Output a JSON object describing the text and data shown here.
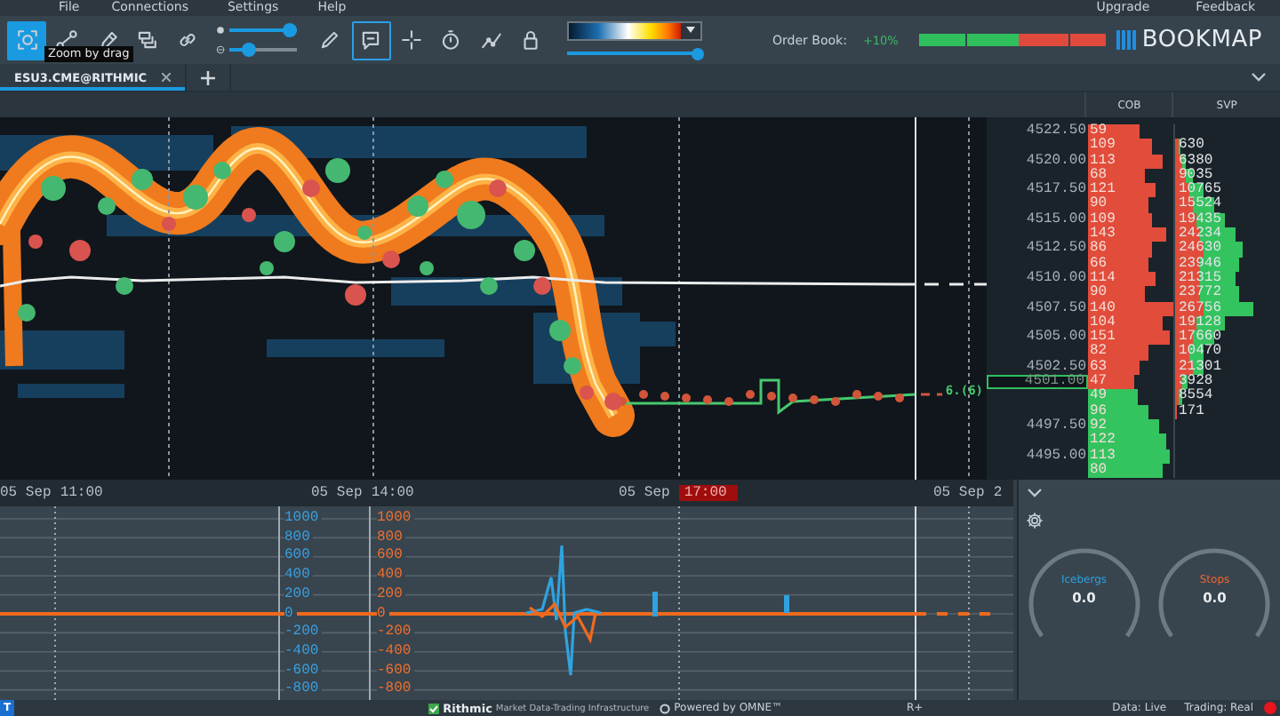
{
  "menu": {
    "left": [
      "File",
      "Connections",
      "Settings",
      "Help"
    ],
    "right": [
      "Upgrade",
      "Feedback"
    ]
  },
  "toolbar": {
    "tools_left": [
      {
        "selected": true,
        "highlighted": false
      },
      {
        "selected": false,
        "highlighted": false
      },
      {
        "selected": false,
        "highlighted": false
      },
      {
        "selected": false,
        "highlighted": false
      },
      {
        "selected": false,
        "highlighted": false
      }
    ],
    "tooltip": "Zoom by drag",
    "sliders": [
      {
        "level": 0.9
      },
      {
        "level": 0.3
      }
    ],
    "tools_right": [
      {
        "selected": false,
        "highlighted": false
      },
      {
        "selected": false,
        "highlighted": true
      },
      {
        "selected": false,
        "highlighted": false
      },
      {
        "selected": false,
        "highlighted": false
      },
      {
        "selected": false,
        "highlighted": false
      },
      {
        "selected": false,
        "highlighted": false
      }
    ],
    "color_scale": {
      "level": 0.98
    },
    "order_book": {
      "label": "Order Book:",
      "change": "+10%",
      "level": 0.53
    },
    "logo": "BOOKMAP"
  },
  "tabs": [
    {
      "label": "ESU3.CME@RITHMIC",
      "selected": true
    }
  ],
  "columns": [
    "COB",
    "SVP"
  ],
  "price_ladder": [
    {
      "price": "4522.50",
      "cob": "59",
      "kind": "ask",
      "current": false
    },
    {
      "cob": "109",
      "kind": "ask",
      "svp": "630",
      "current": false
    },
    {
      "price": "4520.00",
      "cob": "113",
      "kind": "ask",
      "svp": "6380",
      "current": false
    },
    {
      "cob": "68",
      "kind": "ask",
      "svp": "9035",
      "current": false
    },
    {
      "price": "4517.50",
      "cob": "121",
      "kind": "ask",
      "svp": "10765",
      "current": false
    },
    {
      "cob": "90",
      "kind": "ask",
      "svp": "15524",
      "current": false
    },
    {
      "price": "4515.00",
      "cob": "109",
      "kind": "ask",
      "svp": "19435",
      "current": false
    },
    {
      "cob": "143",
      "kind": "ask",
      "svp": "24234",
      "current": false
    },
    {
      "price": "4512.50",
      "cob": "86",
      "kind": "ask",
      "svp": "24630",
      "current": false
    },
    {
      "cob": "66",
      "kind": "ask",
      "svp": "23946",
      "current": false
    },
    {
      "price": "4510.00",
      "cob": "114",
      "kind": "ask",
      "svp": "21315",
      "current": false
    },
    {
      "cob": "90",
      "kind": "ask",
      "svp": "23772",
      "current": false
    },
    {
      "price": "4507.50",
      "cob": "140",
      "kind": "ask",
      "svp": "26756",
      "current": false
    },
    {
      "cob": "104",
      "kind": "ask",
      "svp": "19128",
      "current": false
    },
    {
      "price": "4505.00",
      "cob": "151",
      "kind": "ask",
      "svp": "17660",
      "current": false
    },
    {
      "cob": "82",
      "kind": "ask",
      "svp": "10470",
      "current": false
    },
    {
      "price": "4502.50",
      "cob": "63",
      "kind": "ask",
      "svp": "21301",
      "current": false
    },
    {
      "price": "4501.00",
      "cob": "47",
      "kind": "ask",
      "svp": "3928",
      "current": true
    },
    {
      "cob": "49",
      "kind": "bid",
      "svp": "8554",
      "current": false
    },
    {
      "cob": "96",
      "kind": "bid",
      "svp": "171",
      "current": false
    },
    {
      "price": "4497.50",
      "cob": "92",
      "kind": "bid",
      "current": false
    },
    {
      "cob": "122",
      "kind": "bid",
      "current": false
    },
    {
      "price": "4495.00",
      "cob": "113",
      "kind": "bid",
      "current": false
    },
    {
      "cob": "80",
      "kind": "bid",
      "current": false
    }
  ],
  "chart": {
    "position_label": "6.(6)",
    "time_labels": [
      {
        "date": "05 Sep",
        "time": "11:00",
        "current": false
      },
      {
        "date": "05 Sep",
        "time": "14:00",
        "current": false
      },
      {
        "date": "05 Sep",
        "time": "17:00",
        "current": true
      },
      {
        "date": "05 Sep",
        "time": "2",
        "current": false
      }
    ]
  },
  "indicator": {
    "left_axis": [
      "1000",
      "800",
      "600",
      "400",
      "200",
      "0",
      "-200",
      "-400",
      "-600",
      "-800"
    ],
    "right_axis": [
      "1000",
      "800",
      "600",
      "400",
      "200",
      "0",
      "-200",
      "-400",
      "-600",
      "-800"
    ]
  },
  "side_panel": {
    "gauges": [
      {
        "label": "Icebergs",
        "value": "0.0",
        "color": "#2f9fe0"
      },
      {
        "label": "Stops",
        "value": "0.0",
        "color": "#f0642a"
      }
    ]
  },
  "status_bar": {
    "badge": "T",
    "provider": "Rithmic",
    "tagline": "Market Data-Trading Infrastructure",
    "powered": "Powered by OMNE™",
    "mode": "R+",
    "data": "Data: Live",
    "trading": "Trading: Real",
    "connected": false
  }
}
